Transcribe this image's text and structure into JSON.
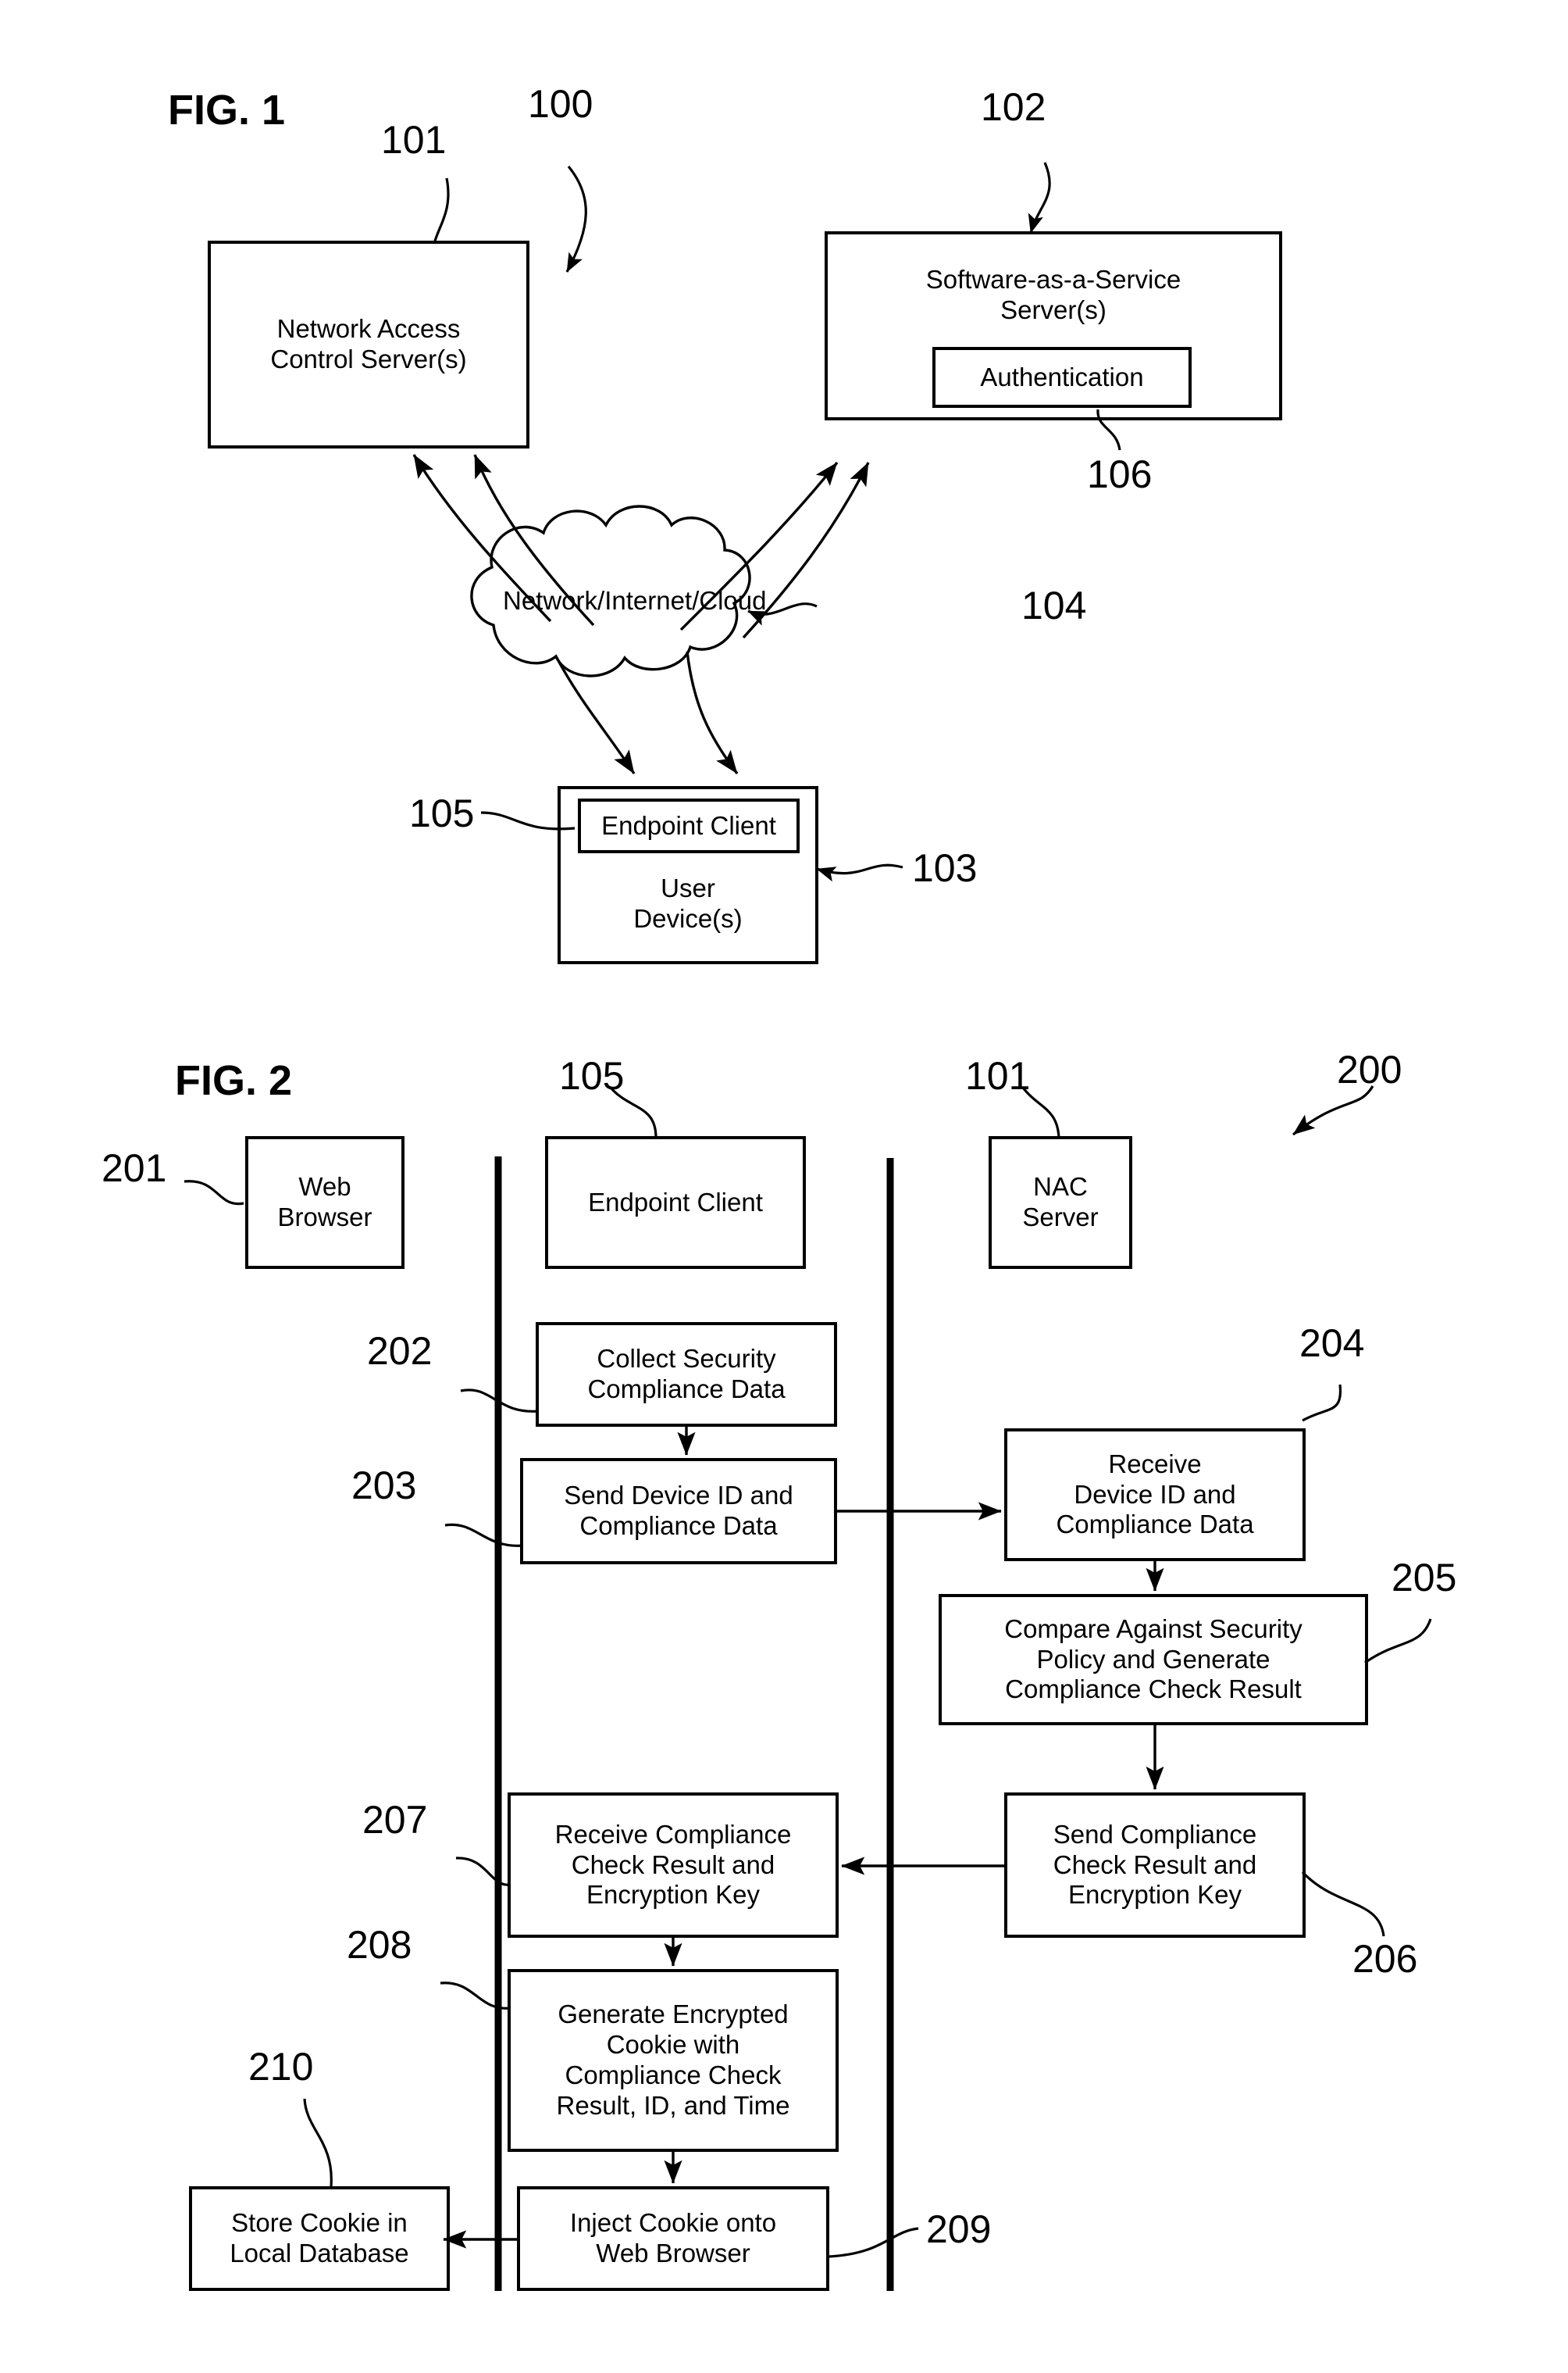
{
  "figures": [
    {
      "id": "fig1",
      "title": "FIG. 1",
      "system_ref": "100",
      "nodes": {
        "nac_server": {
          "label": "Network Access\nControl Server(s)",
          "ref": "101"
        },
        "saas_server": {
          "label": "Software-as-a-Service\nServer(s)",
          "ref": "102"
        },
        "authentication": {
          "label": "Authentication",
          "ref": "106"
        },
        "cloud": {
          "label": "Network/Internet/Cloud",
          "ref": "104"
        },
        "user_device": {
          "label": "User\nDevice(s)",
          "ref": "103"
        },
        "endpoint_client": {
          "label": "Endpoint Client",
          "ref": "105"
        }
      }
    },
    {
      "id": "fig2",
      "title": "FIG. 2",
      "system_ref": "200",
      "lanes": [
        {
          "name": "web-browser-lane"
        },
        {
          "name": "endpoint-client-lane"
        },
        {
          "name": "nac-server-lane"
        }
      ],
      "headers": {
        "web_browser": {
          "label": "Web\nBrowser",
          "ref": "201"
        },
        "endpoint_client": {
          "label": "Endpoint Client",
          "ref": "105"
        },
        "nac_server": {
          "label": "NAC\nServer",
          "ref": "101"
        }
      },
      "steps": [
        {
          "ref": "202",
          "label": "Collect Security\nCompliance Data",
          "lane": "endpoint-client"
        },
        {
          "ref": "203",
          "label": "Send Device ID and\nCompliance Data",
          "lane": "endpoint-client"
        },
        {
          "ref": "204",
          "label": "Receive\nDevice ID and\nCompliance Data",
          "lane": "nac-server"
        },
        {
          "ref": "205",
          "label": "Compare Against Security\nPolicy and Generate\nCompliance Check Result",
          "lane": "nac-server"
        },
        {
          "ref": "206",
          "label": "Send Compliance\nCheck Result and\nEncryption Key",
          "lane": "nac-server"
        },
        {
          "ref": "207",
          "label": "Receive Compliance\nCheck Result and\nEncryption Key",
          "lane": "endpoint-client"
        },
        {
          "ref": "208",
          "label": "Generate Encrypted\nCookie with\nCompliance Check\nResult, ID, and Time",
          "lane": "endpoint-client"
        },
        {
          "ref": "209",
          "label": "Inject Cookie onto\nWeb Browser",
          "lane": "endpoint-client"
        },
        {
          "ref": "210",
          "label": "Store Cookie in\nLocal Database",
          "lane": "web-browser"
        }
      ]
    }
  ],
  "colors": {
    "ink": "#000000",
    "paper": "#ffffff"
  }
}
